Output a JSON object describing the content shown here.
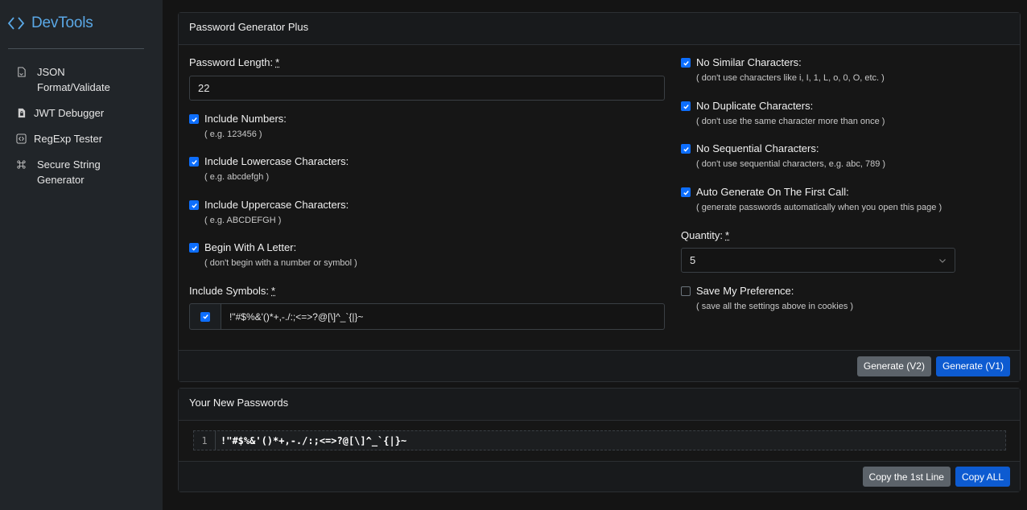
{
  "brand": {
    "name": "DevTools",
    "accent": "#5aa8e6"
  },
  "sidebar": {
    "items": [
      {
        "label": "JSON Format/Validate",
        "icon": "file-icon"
      },
      {
        "label": "JWT Debugger",
        "icon": "file-lock-icon"
      },
      {
        "label": "RegExp Tester",
        "icon": "code-square-icon"
      },
      {
        "label": "Secure String Generator",
        "icon": "command-icon"
      }
    ]
  },
  "generator": {
    "title": "Password Generator Plus",
    "length_label": "Password Length:",
    "required_mark": "*",
    "length_value": "22",
    "left_options": [
      {
        "label": "Include Numbers:",
        "hint": "( e.g. 123456 )",
        "checked": true
      },
      {
        "label": "Include Lowercase Characters:",
        "hint": "( e.g. abcdefgh )",
        "checked": true
      },
      {
        "label": "Include Uppercase Characters:",
        "hint": "( e.g. ABCDEFGH )",
        "checked": true
      },
      {
        "label": "Begin With A Letter:",
        "hint": "( don't begin with a number or symbol )",
        "checked": true
      }
    ],
    "symbols_label": "Include Symbols:",
    "symbols_value": "!\"#$%&'()*+,-./:;<=>?@[\\]^_`{|}~",
    "symbols_checked": true,
    "right_options": [
      {
        "label": "No Similar Characters:",
        "hint": "( don't use characters like i, I, 1, L, o, 0, O, etc. )",
        "checked": true
      },
      {
        "label": "No Duplicate Characters:",
        "hint": "( don't use the same character more than once )",
        "checked": true
      },
      {
        "label": "No Sequential Characters:",
        "hint": "( don't use sequential characters, e.g. abc, 789 )",
        "checked": true
      },
      {
        "label": "Auto Generate On The First Call:",
        "hint": "( generate passwords automatically when you open this page )",
        "checked": true
      }
    ],
    "quantity_label": "Quantity:",
    "quantity_value": "5",
    "save_pref": {
      "label": "Save My Preference:",
      "hint": "( save all the settings above in cookies )",
      "checked": false
    },
    "btn_v2": "Generate (V2)",
    "btn_v1": "Generate (V1)"
  },
  "results": {
    "title": "Your New Passwords",
    "lines": [
      {
        "num": "1",
        "text": "!\"#$%&'()*+,-./:;<=>?@[\\]^_`{|}~"
      }
    ],
    "copy_first": "Copy the 1st Line",
    "copy_all": "Copy ALL"
  }
}
